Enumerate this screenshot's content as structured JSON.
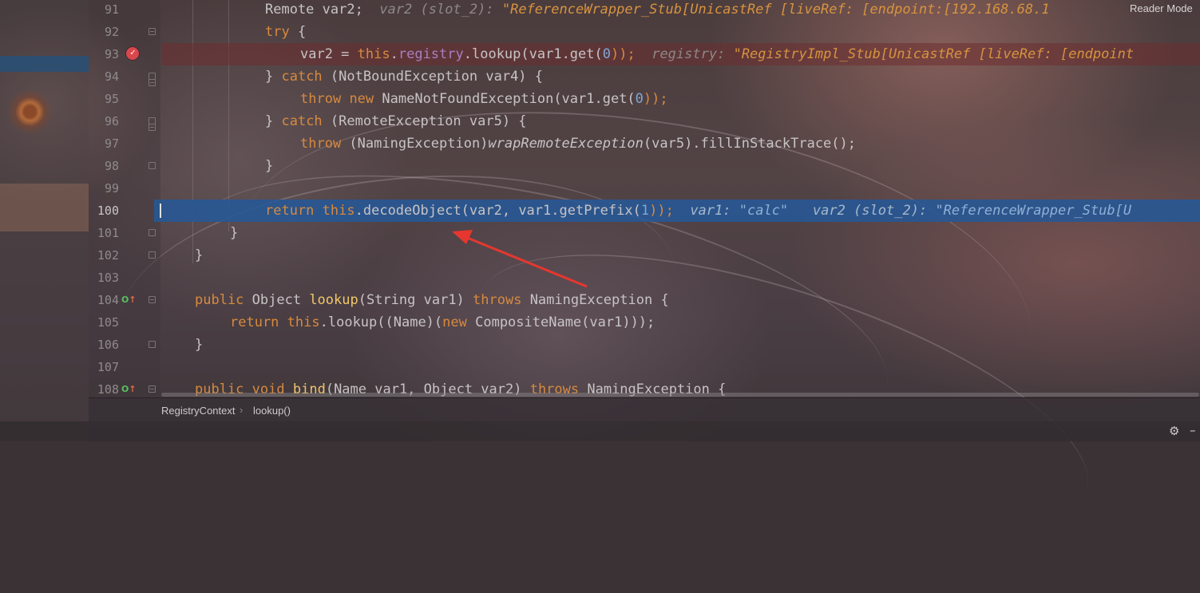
{
  "editor": {
    "reader_mode_label": "Reader Mode",
    "line_numbers": [
      "91",
      "92",
      "93",
      "94",
      "95",
      "96",
      "97",
      "98",
      "99",
      "100",
      "101",
      "102",
      "103",
      "104",
      "105",
      "106",
      "107",
      "108"
    ],
    "lines": {
      "l91": {
        "code": "Remote var2;",
        "hint_name": "var2 (slot_2):",
        "hint_value": "\"ReferenceWrapper_Stub[UnicastRef [liveRef: [endpoint:[192.168.68.1"
      },
      "l92": {
        "kw": "try",
        "code": " {"
      },
      "l93": {
        "a": "var2 = ",
        "kw_this": "this",
        "dot": ".",
        "field": "registry",
        "b": ".lookup(var1.get(",
        "num": "0",
        "c": "));",
        "hint_name": "registry:",
        "hint_value": "\"RegistryImpl_Stub[UnicastRef [liveRef: [endpoint"
      },
      "l94": {
        "a": "} ",
        "kw": "catch",
        "b": " (NotBoundException var4) {"
      },
      "l95": {
        "kw": "throw",
        "kw2": "new",
        "b": " NameNotFoundException(var1.get(",
        "num": "0",
        "c": "));"
      },
      "l96": {
        "a": "} ",
        "kw": "catch",
        "b": " (RemoteException var5) {"
      },
      "l97": {
        "kw": "throw",
        "b": " (NamingException)",
        "it": "wrapRemoteException",
        "c": "(var5).fillInStackTrace();"
      },
      "l98": {
        "code": "}"
      },
      "l100": {
        "kw": "return",
        "kw_this": "this",
        "b": ".decodeObject(var2, var1.getPrefix(",
        "num": "1",
        "c": "));",
        "hint1_name": "var1:",
        "hint1_value": "\"calc\"",
        "hint2_name": "var2 (slot_2):",
        "hint2_value": "\"ReferenceWrapper_Stub[U"
      },
      "l101": {
        "code": "}"
      },
      "l102": {
        "code": "}"
      },
      "l104": {
        "kw": "public",
        "a": " Object ",
        "fn": "lookup",
        "b": "(String var1) ",
        "kw2": "throws",
        "c": " NamingException {"
      },
      "l105": {
        "kw": "return",
        "kw_this": "this",
        "b": ".lookup((Name)(",
        "kw2": "new",
        "c": " CompositeName(var1)));"
      },
      "l106": {
        "code": "}"
      },
      "l108": {
        "kw": "public",
        "kw2": "void",
        "fn": "bind",
        "b": "(Name var1, Object var2) ",
        "kw3": "throws",
        "c": " NamingException {"
      }
    }
  },
  "breadcrumb": {
    "items": [
      "RegistryContext",
      "lookup()"
    ]
  },
  "colors": {
    "keyword": "#d78a3e",
    "exec_line": "#2658a0",
    "breakpoint": "#d9474d",
    "annotation_arrow": "#e5372f"
  }
}
